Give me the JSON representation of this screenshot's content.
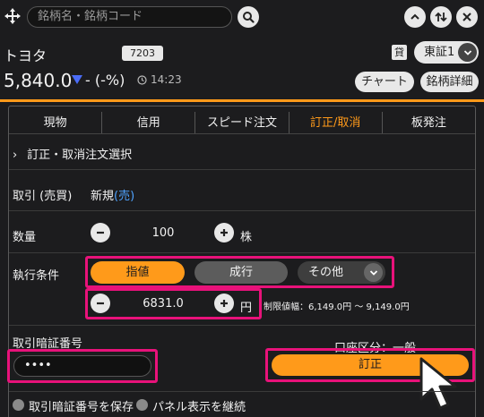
{
  "search": {
    "placeholder": "銘柄名・銘柄コード"
  },
  "stock": {
    "name": "トヨタ",
    "code": "7203",
    "kashi": "貸",
    "market": "東証1",
    "price": "5,840.0",
    "change": "- (-%)",
    "time": "14:23"
  },
  "buttons": {
    "chart": "チャート",
    "detail": "銘柄詳細"
  },
  "tabs": [
    "現物",
    "信用",
    "スピード注文",
    "訂正/取消",
    "板発注"
  ],
  "active_tab": "訂正/取消",
  "section": {
    "title": "訂正・取消注文選択"
  },
  "form": {
    "trade_label": "取引 (売買)",
    "trade_value": "新規",
    "trade_side": "(売)",
    "qty_label": "数量",
    "qty_value": "100",
    "qty_unit": "株",
    "cond_label": "執行条件",
    "cond_options": [
      "指値",
      "成行",
      "その他"
    ],
    "cond_selected": "指値",
    "limit_price": "6831.0",
    "price_unit": "円",
    "price_range": "制限値幅：6,149.0円 〜 9,149.0円",
    "pwd_label": "取引暗証番号",
    "pwd_value": "••••",
    "account_label": "口座区分：一般",
    "order_button": "訂正",
    "save_pwd": "取引暗証番号を保存",
    "keep_panel": "パネル表示を継続"
  },
  "colors": {
    "accent": "#ff9a1a",
    "highlight": "#e8127a",
    "link": "#4fa3ff",
    "down": "#4a6cf7"
  }
}
